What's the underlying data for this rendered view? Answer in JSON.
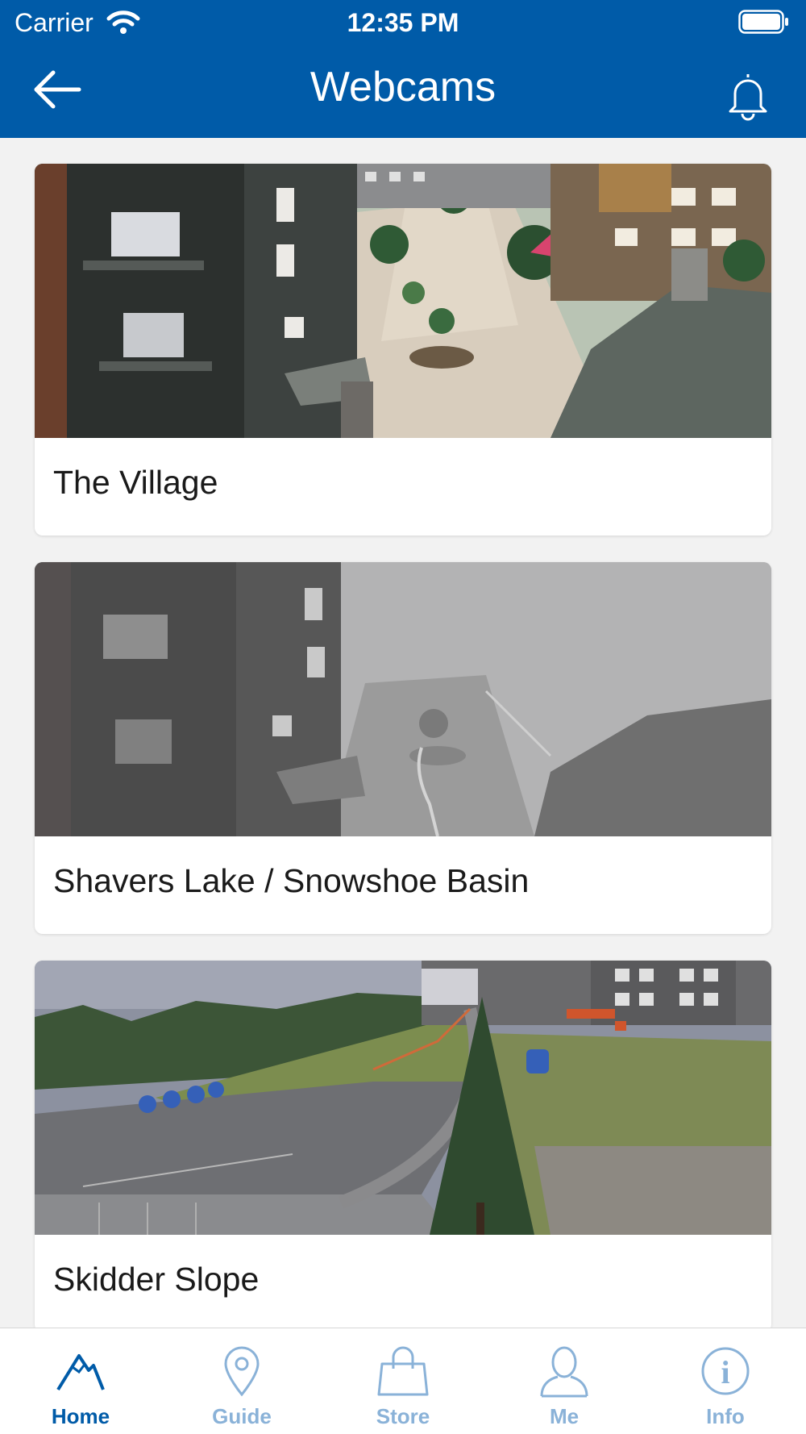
{
  "status_bar": {
    "carrier": "Carrier",
    "time": "12:35 PM"
  },
  "header": {
    "title": "Webcams"
  },
  "webcams": [
    {
      "name": "The Village"
    },
    {
      "name": "Shavers Lake / Snowshoe Basin"
    },
    {
      "name": "Skidder Slope"
    }
  ],
  "tabs": [
    {
      "label": "Home",
      "icon": "mountain-icon",
      "active": true
    },
    {
      "label": "Guide",
      "icon": "map-pin-icon",
      "active": false
    },
    {
      "label": "Store",
      "icon": "shopping-bag-icon",
      "active": false
    },
    {
      "label": "Me",
      "icon": "person-icon",
      "active": false
    },
    {
      "label": "Info",
      "icon": "info-icon",
      "active": false
    }
  ],
  "colors": {
    "brand": "#005ba8",
    "tab_inactive": "#8ab2d8",
    "background": "#f2f2f2"
  }
}
